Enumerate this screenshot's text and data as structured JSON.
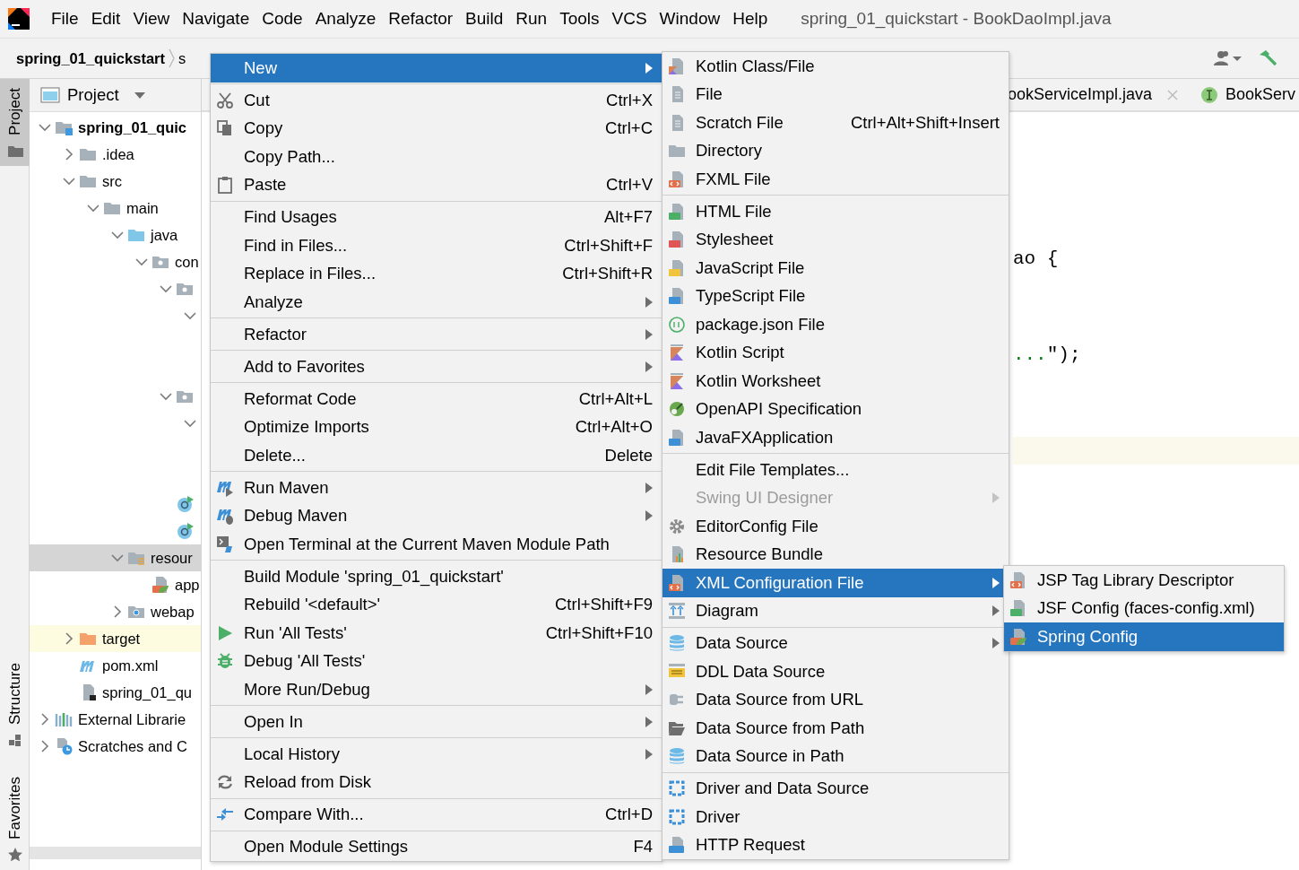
{
  "menu_bar": {
    "items": [
      "File",
      "Edit",
      "View",
      "Navigate",
      "Code",
      "Analyze",
      "Refactor",
      "Build",
      "Run",
      "Tools",
      "VCS",
      "Window",
      "Help"
    ],
    "window_title": "spring_01_quickstart - BookDaoImpl.java"
  },
  "breadcrumbs": [
    "spring_01_quickstart",
    "s"
  ],
  "tool_stripe": [
    {
      "label": "Project",
      "selected": true
    },
    {
      "label": "Structure",
      "selected": false
    },
    {
      "label": "Favorites",
      "selected": false
    }
  ],
  "project_panel": {
    "title": "Project",
    "tree": [
      {
        "label": "spring_01_quic",
        "expanded": true,
        "selected": false,
        "highlighted": false,
        "children": [
          {
            "label": ".idea",
            "expanded": false,
            "selected": false,
            "highlighted": false
          },
          {
            "label": "src",
            "expanded": true,
            "selected": false,
            "highlighted": false,
            "children": [
              {
                "label": "main",
                "expanded": true,
                "selected": false,
                "highlighted": false,
                "children": [
                  {
                    "label": "java",
                    "expanded": true,
                    "selected": false,
                    "highlighted": false,
                    "children": [
                      {
                        "label": "con",
                        "expanded": true,
                        "selected": false,
                        "highlighted": false,
                        "children": [
                          {
                            "expanded": true,
                            "selected": false,
                            "highlighted": false,
                            "children": [
                              {
                                "expanded": true,
                                "selected": false,
                                "highlighted": false
                              }
                            ]
                          },
                          {
                            "expanded": true,
                            "selected": false,
                            "highlighted": false,
                            "children": [
                              {
                                "expanded": true,
                                "selected": false,
                                "highlighted": false
                              }
                            ]
                          },
                          {
                            "selected": false,
                            "highlighted": false
                          },
                          {
                            "selected": false,
                            "highlighted": false
                          }
                        ]
                      }
                    ]
                  },
                  {
                    "label": "resour",
                    "expanded": true,
                    "selected": true,
                    "highlighted": false,
                    "children": [
                      {
                        "label": "app",
                        "selected": false,
                        "highlighted": false
                      }
                    ]
                  },
                  {
                    "label": "webap",
                    "expanded": false,
                    "selected": false,
                    "highlighted": false
                  }
                ]
              }
            ]
          },
          {
            "label": "target",
            "expanded": false,
            "selected": false,
            "highlighted": true
          },
          {
            "label": "pom.xml",
            "selected": false,
            "highlighted": false
          },
          {
            "label": "spring_01_qu",
            "selected": false,
            "highlighted": false
          }
        ]
      },
      {
        "label": "External Librarie",
        "expanded": false,
        "selected": false,
        "highlighted": false
      },
      {
        "label": "Scratches and C",
        "expanded": false,
        "selected": false,
        "highlighted": false
      }
    ]
  },
  "editor": {
    "tabs": [
      {
        "label": "ookServiceImpl.java",
        "selected": false,
        "closable": true
      },
      {
        "label": "BookServ",
        "selected": false,
        "closable": false
      }
    ],
    "code_lines": [
      [
        {
          "text": "ao {",
          "kind": "plain"
        }
      ],
      [
        {
          "text": "...",
          "kind": "string"
        },
        {
          "text": "\");",
          "kind": "plain"
        }
      ]
    ]
  },
  "context_menu": {
    "groups": [
      [
        {
          "label": "New",
          "submenu": true,
          "selected": true
        }
      ],
      [
        {
          "label": "Cut",
          "shortcut": "Ctrl+X",
          "submenu": false,
          "selected": false
        },
        {
          "label": "Copy",
          "shortcut": "Ctrl+C",
          "submenu": false,
          "selected": false
        },
        {
          "label": "Copy Path...",
          "submenu": false,
          "selected": false
        },
        {
          "label": "Paste",
          "shortcut": "Ctrl+V",
          "submenu": false,
          "selected": false
        }
      ],
      [
        {
          "label": "Find Usages",
          "shortcut": "Alt+F7",
          "submenu": false,
          "selected": false
        },
        {
          "label": "Find in Files...",
          "shortcut": "Ctrl+Shift+F",
          "submenu": false,
          "selected": false
        },
        {
          "label": "Replace in Files...",
          "shortcut": "Ctrl+Shift+R",
          "submenu": false,
          "selected": false
        },
        {
          "label": "Analyze",
          "submenu": true,
          "selected": false
        }
      ],
      [
        {
          "label": "Refactor",
          "submenu": true,
          "selected": false
        }
      ],
      [
        {
          "label": "Add to Favorites",
          "submenu": true,
          "selected": false
        }
      ],
      [
        {
          "label": "Reformat Code",
          "shortcut": "Ctrl+Alt+L",
          "submenu": false,
          "selected": false
        },
        {
          "label": "Optimize Imports",
          "shortcut": "Ctrl+Alt+O",
          "submenu": false,
          "selected": false
        },
        {
          "label": "Delete...",
          "shortcut": "Delete",
          "submenu": false,
          "selected": false
        }
      ],
      [
        {
          "label": "Run Maven",
          "submenu": true,
          "selected": false
        },
        {
          "label": "Debug Maven",
          "submenu": true,
          "selected": false
        },
        {
          "label": "Open Terminal at the Current Maven Module Path",
          "submenu": false,
          "selected": false
        }
      ],
      [
        {
          "label": "Build Module 'spring_01_quickstart'",
          "submenu": false,
          "selected": false
        },
        {
          "label": "Rebuild '<default>'",
          "shortcut": "Ctrl+Shift+F9",
          "submenu": false,
          "selected": false
        },
        {
          "label": "Run 'All Tests'",
          "shortcut": "Ctrl+Shift+F10",
          "submenu": false,
          "selected": false
        },
        {
          "label": "Debug 'All Tests'",
          "submenu": false,
          "selected": false
        },
        {
          "label": "More Run/Debug",
          "submenu": true,
          "selected": false
        }
      ],
      [
        {
          "label": "Open In",
          "submenu": true,
          "selected": false
        }
      ],
      [
        {
          "label": "Local History",
          "submenu": true,
          "selected": false
        },
        {
          "label": "Reload from Disk",
          "submenu": false,
          "selected": false
        }
      ],
      [
        {
          "label": "Compare With...",
          "shortcut": "Ctrl+D",
          "submenu": false,
          "selected": false
        }
      ],
      [
        {
          "label": "Open Module Settings",
          "shortcut": "F4",
          "submenu": false,
          "selected": false
        }
      ]
    ]
  },
  "new_submenu": {
    "groups": [
      [
        {
          "label": "Kotlin Class/File",
          "submenu": false,
          "selected": false,
          "disabled": false
        },
        {
          "label": "File",
          "submenu": false,
          "selected": false,
          "disabled": false
        },
        {
          "label": "Scratch File",
          "shortcut": "Ctrl+Alt+Shift+Insert",
          "submenu": false,
          "selected": false,
          "disabled": false
        },
        {
          "label": "Directory",
          "submenu": false,
          "selected": false,
          "disabled": false
        },
        {
          "label": "FXML File",
          "submenu": false,
          "selected": false,
          "disabled": false
        }
      ],
      [
        {
          "label": "HTML File",
          "submenu": false,
          "selected": false,
          "disabled": false
        },
        {
          "label": "Stylesheet",
          "submenu": false,
          "selected": false,
          "disabled": false
        },
        {
          "label": "JavaScript File",
          "submenu": false,
          "selected": false,
          "disabled": false
        },
        {
          "label": "TypeScript File",
          "submenu": false,
          "selected": false,
          "disabled": false
        },
        {
          "label": "package.json File",
          "submenu": false,
          "selected": false,
          "disabled": false
        },
        {
          "label": "Kotlin Script",
          "submenu": false,
          "selected": false,
          "disabled": false
        },
        {
          "label": "Kotlin Worksheet",
          "submenu": false,
          "selected": false,
          "disabled": false
        },
        {
          "label": "OpenAPI Specification",
          "submenu": false,
          "selected": false,
          "disabled": false
        },
        {
          "label": "JavaFXApplication",
          "submenu": false,
          "selected": false,
          "disabled": false
        }
      ],
      [
        {
          "label": "Edit File Templates...",
          "submenu": false,
          "selected": false,
          "disabled": false
        },
        {
          "label": "Swing UI Designer",
          "submenu": true,
          "selected": false,
          "disabled": true
        },
        {
          "label": "EditorConfig File",
          "submenu": false,
          "selected": false,
          "disabled": false
        },
        {
          "label": "Resource Bundle",
          "submenu": false,
          "selected": false,
          "disabled": false
        },
        {
          "label": "XML Configuration File",
          "submenu": true,
          "selected": true,
          "disabled": false
        },
        {
          "label": "Diagram",
          "submenu": true,
          "selected": false,
          "disabled": false
        }
      ],
      [
        {
          "label": "Data Source",
          "submenu": true,
          "selected": false,
          "disabled": false
        },
        {
          "label": "DDL Data Source",
          "submenu": false,
          "selected": false,
          "disabled": false
        },
        {
          "label": "Data Source from URL",
          "submenu": false,
          "selected": false,
          "disabled": false
        },
        {
          "label": "Data Source from Path",
          "submenu": false,
          "selected": false,
          "disabled": false
        },
        {
          "label": "Data Source in Path",
          "submenu": false,
          "selected": false,
          "disabled": false
        }
      ],
      [
        {
          "label": "Driver and Data Source",
          "submenu": false,
          "selected": false,
          "disabled": false
        },
        {
          "label": "Driver",
          "submenu": false,
          "selected": false,
          "disabled": false
        },
        {
          "label": "HTTP Request",
          "submenu": false,
          "selected": false,
          "disabled": false
        }
      ]
    ]
  },
  "xml_submenu": {
    "groups": [
      [
        {
          "label": "JSP Tag Library Descriptor",
          "submenu": false,
          "selected": false
        },
        {
          "label": "JSF Config (faces-config.xml)",
          "submenu": false,
          "selected": false
        },
        {
          "label": "Spring Config",
          "submenu": false,
          "selected": true
        }
      ]
    ]
  }
}
